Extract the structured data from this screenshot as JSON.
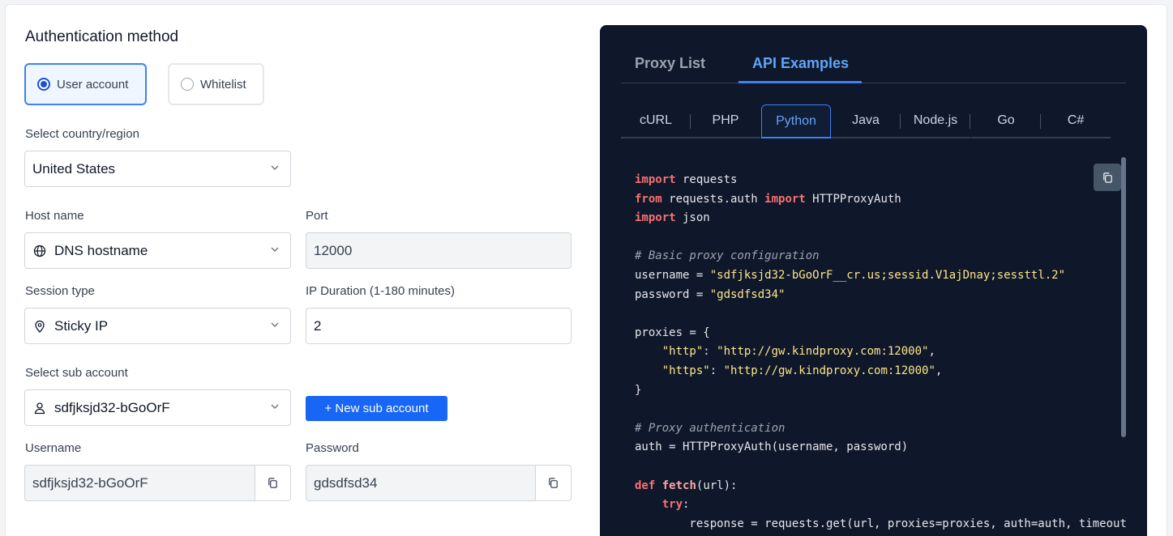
{
  "left": {
    "auth_title": "Authentication method",
    "auth_options": [
      {
        "label": "User account",
        "selected": true
      },
      {
        "label": "Whitelist",
        "selected": false
      }
    ],
    "country_label": "Select country/region",
    "country_value": "United States",
    "host_label": "Host name",
    "host_value": "DNS hostname",
    "port_label": "Port",
    "port_value": "12000",
    "session_label": "Session type",
    "session_value": "Sticky IP",
    "duration_label": "IP Duration (1-180 minutes)",
    "duration_value": "2",
    "sub_label": "Select sub account",
    "sub_value": "sdfjksjd32-bGoOrF",
    "new_sub_button": "+ New sub account",
    "username_label": "Username",
    "username_value": "sdfjksjd32-bGoOrF",
    "password_label": "Password",
    "password_value": "gdsdfsd34"
  },
  "right": {
    "tabs": [
      {
        "label": "Proxy List",
        "active": false
      },
      {
        "label": "API Examples",
        "active": true
      }
    ],
    "languages": [
      {
        "label": "cURL",
        "active": false
      },
      {
        "label": "PHP",
        "active": false
      },
      {
        "label": "Python",
        "active": true
      },
      {
        "label": "Java",
        "active": false
      },
      {
        "label": "Node.js",
        "active": false
      },
      {
        "label": "Go",
        "active": false
      },
      {
        "label": "C#",
        "active": false
      }
    ],
    "code_lines": [
      "import requests",
      "from requests.auth import HTTPProxyAuth",
      "import json",
      "",
      "# Basic proxy configuration",
      "username = \"sdfjksjd32-bGoOrF__cr.us;sessid.V1ajDnay;sessttl.2\"",
      "password = \"gdsdfsd34\"",
      "",
      "proxies = {",
      "    \"http\": \"http://gw.kindproxy.com:12000\",",
      "    \"https\": \"http://gw.kindproxy.com:12000\",",
      "}",
      "",
      "# Proxy authentication",
      "auth = HTTPProxyAuth(username, password)",
      "",
      "def fetch(url):",
      "    try:",
      "        response = requests.get(url, proxies=proxies, auth=auth, timeout"
    ]
  },
  "colors": {
    "accent": "#1766f5",
    "panel_bg": "#0f172a",
    "keyword": "#f87171",
    "string": "#fde68a"
  },
  "icons": {
    "chevron": "chevron-down-icon",
    "globe": "globe-icon",
    "pin": "location-pin-icon",
    "user": "user-icon",
    "copy": "copy-icon"
  }
}
